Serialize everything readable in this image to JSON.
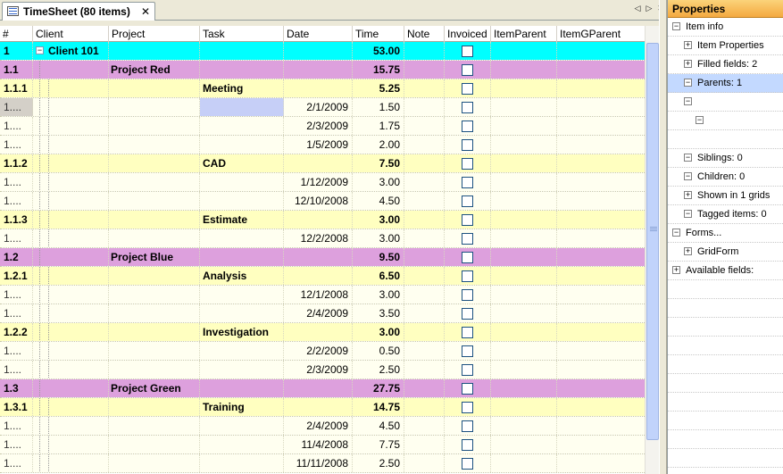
{
  "tab": {
    "title": "TimeSheet (80 items)",
    "close": "✕"
  },
  "nav": {
    "prev": "◁",
    "next": "▷",
    "close": "✕"
  },
  "columns": [
    "#",
    "Client",
    "Project",
    "Task",
    "Date",
    "Time",
    "Note",
    "Invoiced",
    "ItemParent",
    "ItemGParent"
  ],
  "rows": [
    {
      "num": "1",
      "level": 0,
      "label": "Client 101",
      "date": "",
      "time": "53.00"
    },
    {
      "num": "1.1",
      "level": 1,
      "label": "Project Red",
      "date": "",
      "time": "15.75"
    },
    {
      "num": "1.1.1",
      "level": 2,
      "label": "Meeting",
      "date": "",
      "time": "5.25"
    },
    {
      "num": "1....",
      "level": 3,
      "label": "",
      "date": "2/1/2009",
      "time": "1.50",
      "selected": true
    },
    {
      "num": "1....",
      "level": 3,
      "label": "",
      "date": "2/3/2009",
      "time": "1.75"
    },
    {
      "num": "1....",
      "level": 3,
      "label": "",
      "date": "1/5/2009",
      "time": "2.00",
      "last": true
    },
    {
      "num": "1.1.2",
      "level": 2,
      "label": "CAD",
      "date": "",
      "time": "7.50"
    },
    {
      "num": "1....",
      "level": 3,
      "label": "",
      "date": "1/12/2009",
      "time": "3.00"
    },
    {
      "num": "1....",
      "level": 3,
      "label": "",
      "date": "12/10/2008",
      "time": "4.50",
      "last": true
    },
    {
      "num": "1.1.3",
      "level": 2,
      "label": "Estimate",
      "date": "",
      "time": "3.00"
    },
    {
      "num": "1....",
      "level": 3,
      "label": "",
      "date": "12/2/2008",
      "time": "3.00",
      "last": true
    },
    {
      "num": "1.2",
      "level": 1,
      "label": "Project Blue",
      "date": "",
      "time": "9.50"
    },
    {
      "num": "1.2.1",
      "level": 2,
      "label": "Analysis",
      "date": "",
      "time": "6.50"
    },
    {
      "num": "1....",
      "level": 3,
      "label": "",
      "date": "12/1/2008",
      "time": "3.00"
    },
    {
      "num": "1....",
      "level": 3,
      "label": "",
      "date": "2/4/2009",
      "time": "3.50",
      "last": true
    },
    {
      "num": "1.2.2",
      "level": 2,
      "label": "Investigation",
      "date": "",
      "time": "3.00"
    },
    {
      "num": "1....",
      "level": 3,
      "label": "",
      "date": "2/2/2009",
      "time": "0.50"
    },
    {
      "num": "1....",
      "level": 3,
      "label": "",
      "date": "2/3/2009",
      "time": "2.50",
      "last": true
    },
    {
      "num": "1.3",
      "level": 1,
      "label": "Project Green",
      "date": "",
      "time": "27.75"
    },
    {
      "num": "1.3.1",
      "level": 2,
      "label": "Training",
      "date": "",
      "time": "14.75"
    },
    {
      "num": "1....",
      "level": 3,
      "label": "",
      "date": "2/4/2009",
      "time": "4.50"
    },
    {
      "num": "1....",
      "level": 3,
      "label": "",
      "date": "11/4/2008",
      "time": "7.75"
    },
    {
      "num": "1....",
      "level": 3,
      "label": "",
      "date": "11/11/2008",
      "time": "2.50"
    }
  ],
  "properties": {
    "title": "Properties",
    "items": [
      {
        "label": "Item info",
        "indent": 0,
        "sign": "−",
        "hl": false
      },
      {
        "label": "Item Properties",
        "indent": 1,
        "sign": "+",
        "hl": false
      },
      {
        "label": "Filled fields: 2",
        "indent": 1,
        "sign": "+",
        "hl": false
      },
      {
        "label": "Parents: 1",
        "indent": 1,
        "sign": "−",
        "hl": true
      },
      {
        "label": "",
        "indent": 1,
        "sign": "−",
        "hl": false
      },
      {
        "label": "",
        "indent": 2,
        "sign": "−",
        "hl": false
      },
      {
        "label": "",
        "indent": 0,
        "sign": "",
        "hl": false
      },
      {
        "label": "Siblings: 0",
        "indent": 1,
        "sign": "−",
        "hl": false
      },
      {
        "label": "Children: 0",
        "indent": 1,
        "sign": "−",
        "hl": false
      },
      {
        "label": "Shown in 1 grids",
        "indent": 1,
        "sign": "+",
        "hl": false
      },
      {
        "label": "Tagged items: 0",
        "indent": 1,
        "sign": "−",
        "hl": false
      },
      {
        "label": "Forms...",
        "indent": 0,
        "sign": "−",
        "hl": false
      },
      {
        "label": "GridForm",
        "indent": 1,
        "sign": "+",
        "hl": false
      },
      {
        "label": "Available fields:",
        "indent": 0,
        "sign": "+",
        "hl": false
      }
    ]
  }
}
